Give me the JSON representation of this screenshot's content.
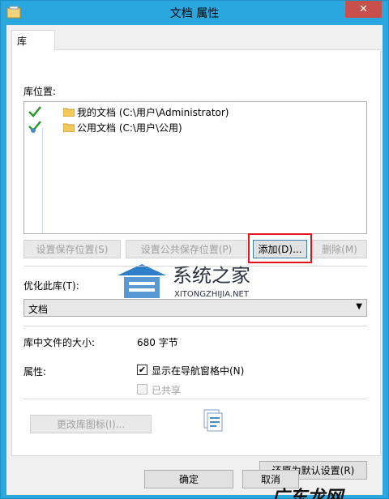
{
  "window": {
    "title": "文档 属性",
    "close_glyph": "✕"
  },
  "tabs": [
    {
      "label": "库"
    }
  ],
  "library_locations": {
    "label": "库位置:",
    "items": [
      {
        "text": "我的文档 (C:\\用户\\Administrator)"
      },
      {
        "text": "公用文档 (C:\\用户\\公用)"
      }
    ]
  },
  "buttons": {
    "set_save_location": "设置保存位置(S)",
    "set_public_save_location": "设置公共保存位置(P)",
    "add": "添加(D)...",
    "remove": "删除(M)",
    "change_icon": "更改库图标(I)...",
    "restore_defaults": "还原为默认设置(R)",
    "ok": "确定",
    "cancel": "取消"
  },
  "optimize": {
    "label": "优化此库(T):",
    "selected": "文档"
  },
  "size": {
    "label": "库中文件的大小:",
    "value": "680 字节"
  },
  "attributes": {
    "label": "属性:",
    "show_in_nav": {
      "label": "显示在导航窗格中(N)",
      "checked": true
    },
    "shared": {
      "label": "已共享",
      "checked": false
    }
  },
  "watermarks": {
    "logo_cn": "系统之家",
    "logo_en": "XITONGZHIJIA.NET",
    "corner": "广东龙网"
  },
  "colors": {
    "titlebar": "#2aa7df",
    "close": "#c7504a",
    "highlight": "#e1141e"
  }
}
